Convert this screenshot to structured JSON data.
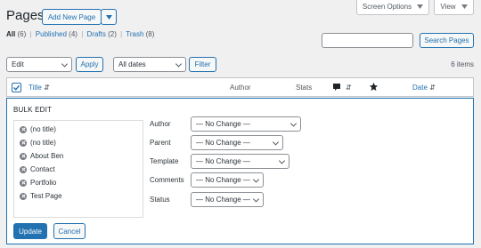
{
  "header": {
    "title": "Pages",
    "add_new_label": "Add New Page",
    "screen_options_label": "Screen Options",
    "view_label": "View"
  },
  "filters": {
    "all": "All",
    "all_count": "(6)",
    "published": "Published",
    "published_count": "(4)",
    "drafts": "Drafts",
    "drafts_count": "(2)",
    "trash": "Trash",
    "trash_count": "(8)",
    "separator": "|"
  },
  "search": {
    "value": "",
    "button_label": "Search Pages"
  },
  "toolbar": {
    "bulk_action_value": "Edit",
    "apply_label": "Apply",
    "dates_value": "All dates",
    "filter_label": "Filter",
    "items_count": "6 items"
  },
  "table": {
    "columns": [
      "Title",
      "Author",
      "Stats",
      "Date"
    ],
    "sort_glyph": "⇵"
  },
  "bulk_edit": {
    "heading": "BULK EDIT",
    "items": [
      "(no title)",
      "(no title)",
      "About Ben",
      "Contact",
      "Portfolio",
      "Test Page"
    ],
    "fields": [
      {
        "label": "Author",
        "value": "— No Change —"
      },
      {
        "label": "Parent",
        "value": "— No Change —"
      },
      {
        "label": "Template",
        "value": "— No Change —"
      },
      {
        "label": "Comments",
        "value": "— No Change —"
      },
      {
        "label": "Status",
        "value": "— No Change —"
      }
    ],
    "update_label": "Update",
    "cancel_label": "Cancel"
  },
  "colors": {
    "accent": "#2271b1",
    "background": "#f0f0f1",
    "border": "#c3c4c7"
  },
  "icons": [
    "chevron-down-icon",
    "checkbox-icon",
    "sort-icon",
    "comment-bubble-icon",
    "star-icon",
    "remove-icon"
  ]
}
